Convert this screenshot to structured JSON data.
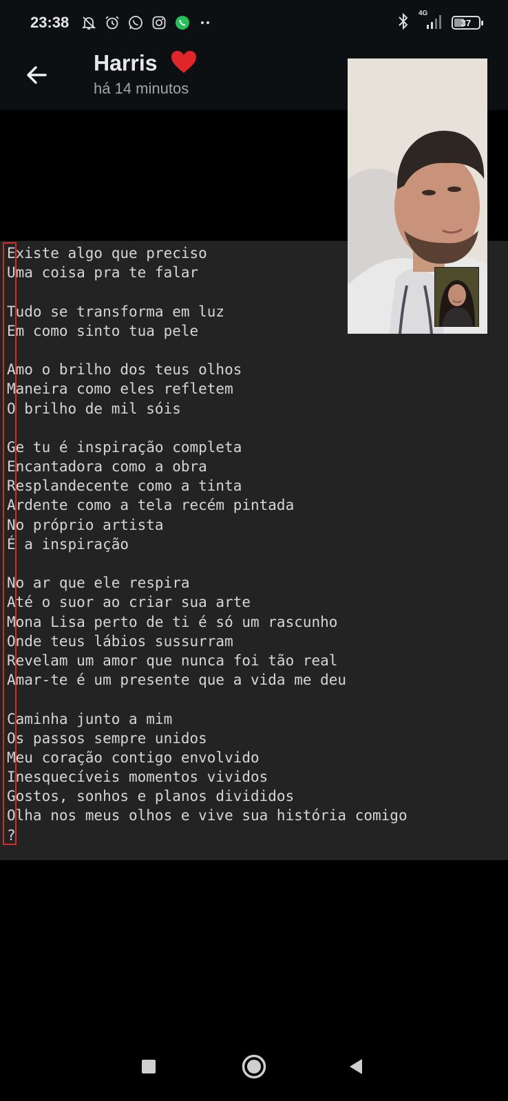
{
  "status_bar": {
    "time": "23:38",
    "network": "4G",
    "battery": "37",
    "icons": [
      "bell-muted-icon",
      "alarm-icon",
      "whatsapp-icon",
      "instagram-icon",
      "whatsapp-business-icon",
      "more-dots-icon",
      "bluetooth-icon",
      "signal-icon",
      "battery-icon"
    ]
  },
  "header": {
    "contact_name": "Harris",
    "last_seen": "há 14 minutos",
    "icons": [
      "back-arrow-icon",
      "heart-icon"
    ]
  },
  "poem": {
    "lines": [
      "Existe algo que preciso",
      "Uma coisa pra te falar",
      "",
      "Tudo se transforma em luz",
      "Em como sinto tua pele",
      "",
      "Amo o brilho dos teus olhos",
      "Maneira como eles refletem",
      "O brilho de mil sóis",
      "",
      "Ge tu é inspiração completa",
      "Encantadora como a obra",
      "Resplandecente como a tinta",
      "Ardente como a tela recém pintada",
      "No próprio artista",
      "É a inspiração",
      "",
      "No ar que ele respira",
      "Até o suor ao criar sua arte",
      "Mona Lisa perto de ti é só um rascunho",
      "Onde teus lábios sussurram",
      "Revelam um amor que nunca foi tão real",
      "Amar-te é um presente que a vida me deu",
      "",
      "Caminha junto a mim",
      "Os passos sempre unidos",
      "Meu coração contigo envolvido",
      "Inesquecíveis momentos vividos",
      "Gostos, sonhos e planos divididos",
      "Olha nos meus olhos e vive sua história comigo",
      "?"
    ]
  },
  "video_call": {
    "icons": [
      "remote-video-feed",
      "self-video-feed"
    ]
  },
  "nav_bar": {
    "icons": [
      "recents-square-icon",
      "home-circle-icon",
      "back-triangle-icon"
    ]
  },
  "colors": {
    "background": "#000000",
    "header_bg": "#0d1013",
    "code_bg": "#232323",
    "code_text": "#d6d6d6",
    "highlight_border": "#d42d2d",
    "heart": "#e0262b"
  }
}
